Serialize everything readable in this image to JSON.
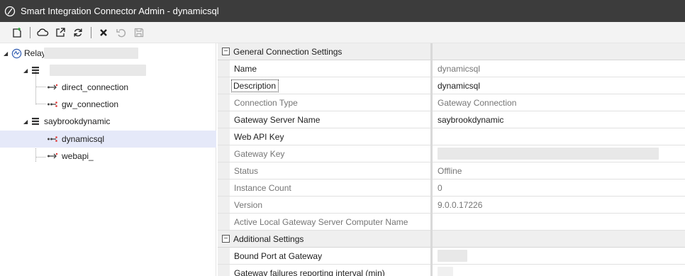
{
  "window": {
    "title": "Smart Integration Connector Admin - dynamicsql"
  },
  "toolbar": {
    "buttons": [
      {
        "name": "new-icon",
        "tooltip": ""
      },
      {
        "name": "cloud-icon",
        "tooltip": ""
      },
      {
        "name": "open-external-icon",
        "tooltip": ""
      },
      {
        "name": "refresh-icon",
        "tooltip": ""
      },
      {
        "name": "delete-icon",
        "tooltip": ""
      },
      {
        "name": "undo-icon",
        "tooltip": ""
      },
      {
        "name": "save-icon",
        "tooltip": ""
      }
    ]
  },
  "tree": {
    "root": {
      "label": "Relay",
      "icon": "relay-icon"
    },
    "gateway1": {
      "icon": "server-icon"
    },
    "connections1": [
      {
        "label": "direct_connection",
        "icon": "direct-connection-icon"
      },
      {
        "label": "gw_connection",
        "icon": "gateway-connection-icon"
      }
    ],
    "gateway2": {
      "label": "saybrookdynamic",
      "icon": "server-icon"
    },
    "connections2": [
      {
        "label": "dynamicsql",
        "icon": "gateway-connection-icon",
        "selected": true
      },
      {
        "label": "webapi_",
        "icon": "direct-connection-icon"
      }
    ]
  },
  "properties": {
    "section1": {
      "label": "General Connection Settings",
      "rows": [
        {
          "name": "Name",
          "value": "dynamicsql",
          "readonly": true
        },
        {
          "name": "Description",
          "value": "dynamicsql",
          "readonly": false,
          "focused": true
        },
        {
          "name": "Connection Type",
          "value": "Gateway Connection",
          "readonly": true
        },
        {
          "name": "Gateway Server Name",
          "value": "saybrookdynamic",
          "readonly": false
        },
        {
          "name": "Web API Key",
          "value": "",
          "readonly": false
        },
        {
          "name": "Gateway Key",
          "value": "",
          "readonly": true,
          "redacted": true
        },
        {
          "name": "Status",
          "value": "Offline",
          "readonly": true
        },
        {
          "name": "Instance Count",
          "value": "0",
          "readonly": true
        },
        {
          "name": "Version",
          "value": "9.0.0.17226",
          "readonly": true
        },
        {
          "name": "Active Local Gateway Server Computer Name",
          "value": "",
          "readonly": true
        }
      ]
    },
    "section2": {
      "label": "Additional Settings",
      "rows": [
        {
          "name": "Bound Port at Gateway",
          "value": "",
          "readonly": false,
          "redacted": true
        },
        {
          "name": "Gateway failures reporting interval (min)",
          "value": "",
          "readonly": false,
          "redacted": true
        }
      ]
    }
  },
  "colors": {
    "titlebar": "#3c3c3c",
    "selection": "#e5e9f9",
    "section_bg": "#efefef"
  }
}
